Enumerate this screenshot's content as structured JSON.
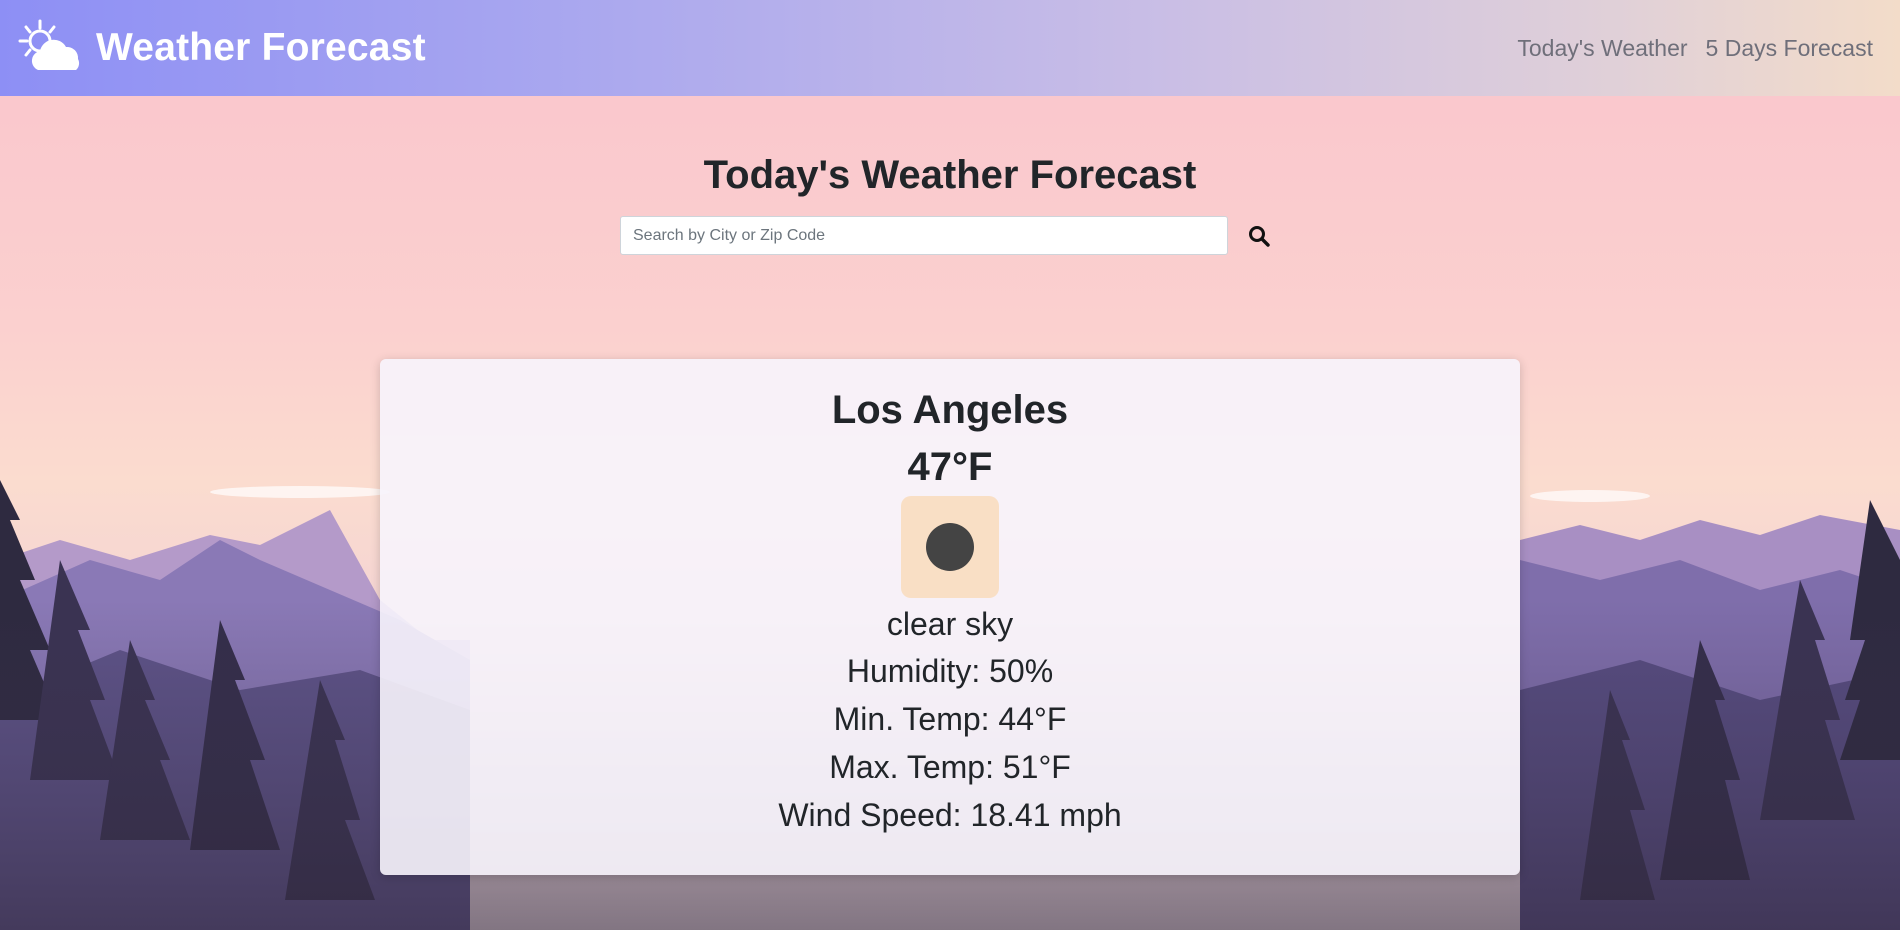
{
  "navbar": {
    "brand_title": "Weather Forecast",
    "brand_icon": "sun-cloud-icon",
    "links": [
      {
        "label": "Today's Weather"
      },
      {
        "label": "5 Days Forecast"
      }
    ],
    "gradient_colors": [
      "#8d8ff5",
      "#a9a7ef",
      "#c8bde6",
      "#e0d0d8",
      "#f3dcc9"
    ]
  },
  "main": {
    "heading": "Today's Weather Forecast",
    "search": {
      "placeholder": "Search by City or Zip Code",
      "value": "",
      "button_icon": "search-icon"
    }
  },
  "weather": {
    "city": "Los Angeles",
    "temperature": "47°F",
    "condition_icon": "clear-sky-icon",
    "description": "clear sky",
    "humidity": "Humidity: 50%",
    "min_temp": "Min. Temp: 44°F",
    "max_temp": "Max. Temp: 51°F",
    "wind_speed": "Wind Speed: 18.41 mph"
  },
  "colors": {
    "card_background": "#f7f4fc",
    "icon_tile": "#f9dfc5",
    "text": "#212529",
    "nav_link": "#6f6f7a"
  }
}
